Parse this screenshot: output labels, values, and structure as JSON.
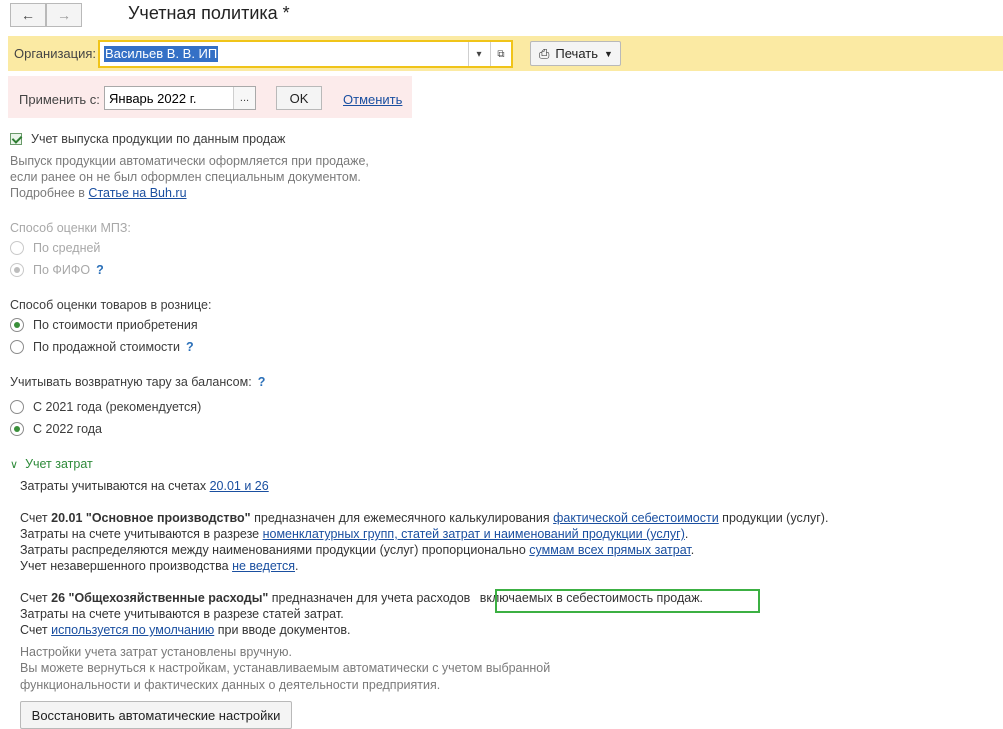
{
  "window": {
    "title": "Учетная политика *"
  },
  "org": {
    "label": "Организация:",
    "value": "Васильев В. В. ИП",
    "print_label": "Печать"
  },
  "apply": {
    "label": "Применить с:",
    "date": "Январь 2022 г.",
    "dots": "...",
    "ok_label": "OK",
    "cancel_label": "Отменить"
  },
  "production": {
    "checkbox_label": "Учет выпуска продукции по данным продаж",
    "desc_line1": "Выпуск продукции автоматически оформляется при продаже,",
    "desc_line2": "если ранее он не был оформлен специальным документом.",
    "more_prefix": "Подробнее в ",
    "more_link": "Статье на Buh.ru"
  },
  "mpz": {
    "label": "Способ оценки МПЗ:",
    "opt_avg": "По средней",
    "opt_fifo": "По ФИФО"
  },
  "retail": {
    "label": "Способ оценки товаров в рознице:",
    "opt_purchase": "По стоимости приобретения",
    "opt_sale": "По продажной стоимости"
  },
  "tare": {
    "label": "Учитывать возвратную тару за балансом:",
    "opt_2021": "С 2021 года (рекомендуется)",
    "opt_2022": "С 2022 года"
  },
  "costs": {
    "section_title": "Учет затрат",
    "accounts_prefix": "Затраты учитываются на счетах ",
    "accounts_link": "20.01 и 26",
    "a2001": {
      "p1": "Счет ",
      "num": "20.01",
      "name": " \"Основное производство\"",
      "p2": " предназначен для ежемесячного калькулирования ",
      "link1": "фактической себестоимости",
      "p3": " продукции (услуг).",
      "l2_prefix": "Затраты на счете учитываются в разрезе ",
      "l2_link": "номенклатурных групп, статей затрат и наименований продукции (услуг)",
      "l2_suffix": ".",
      "l3_prefix": "Затраты распределяются между наименованиями продукции (услуг) пропорционально ",
      "l3_link": "суммам всех прямых затрат",
      "l3_suffix": ".",
      "l4_prefix": "Учет незавершенного производства ",
      "l4_link": "не ведется",
      "l4_suffix": "."
    },
    "a26": {
      "p1": "Счет ",
      "num": "26",
      "name": " \"Общехозяйственные расходы\"",
      "p2": " предназначен для учета расходов ",
      "highlight": "включаемых в себестоимость продаж.",
      "l2": "Затраты на счете учитываются в разрезе статей затрат.",
      "l3_prefix": "Счет ",
      "l3_link": "используется по умолчанию",
      "l3_suffix": " при вводе документов."
    },
    "manual_note1": "Настройки учета затрат установлены вручную.",
    "manual_note2": "Вы можете вернуться к настройкам, устанавливаемым автоматически с учетом выбранной",
    "manual_note3": "функциональности и фактических данных о деятельности предприятия.",
    "restore_label": "Восстановить автоматические настройки"
  },
  "help_mark": "?"
}
